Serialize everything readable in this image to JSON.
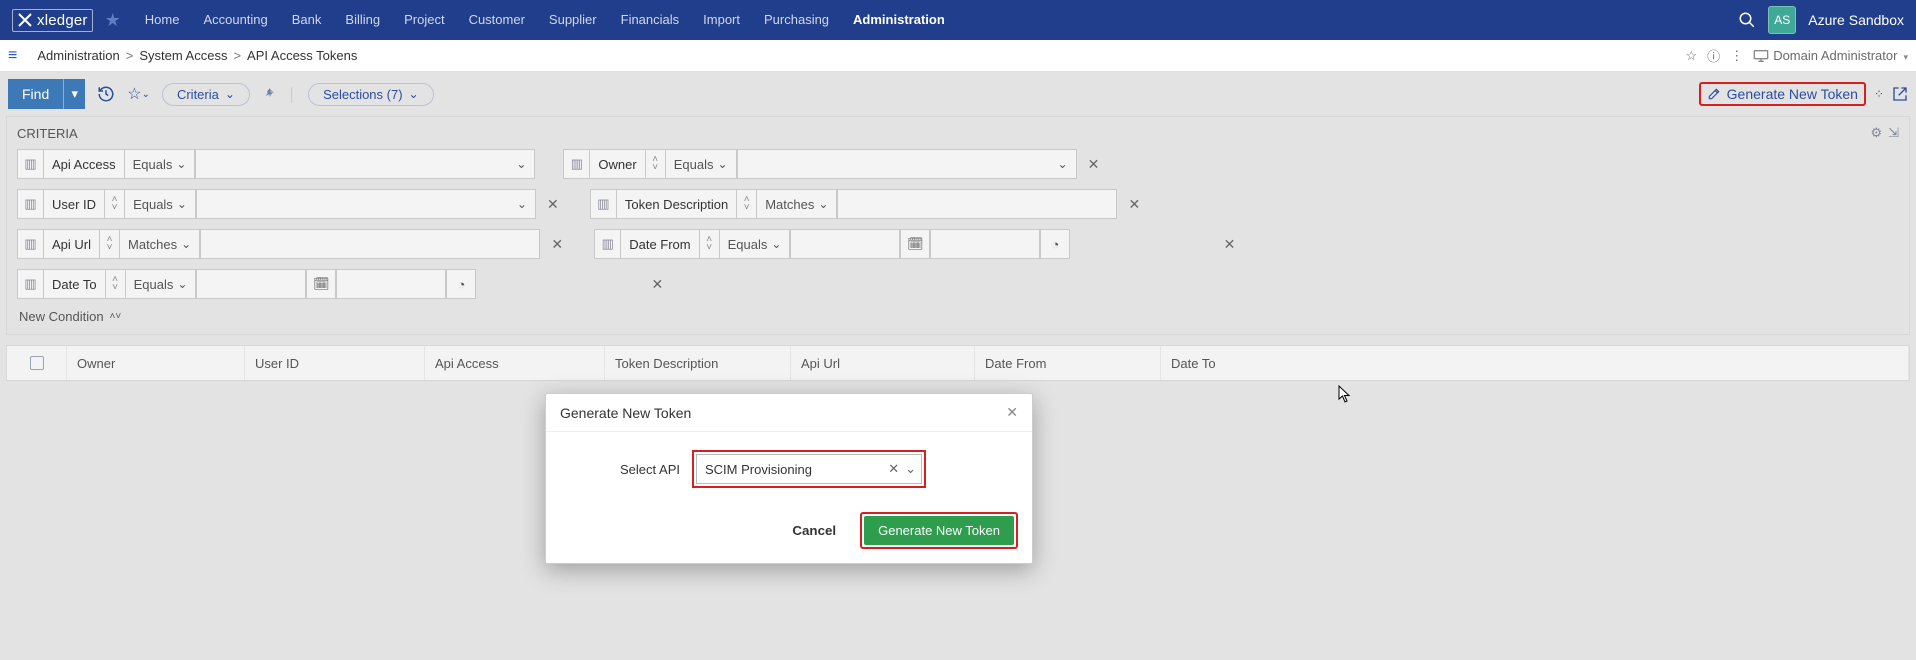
{
  "brand": {
    "name": "xledger"
  },
  "topnav": {
    "items": [
      "Home",
      "Accounting",
      "Bank",
      "Billing",
      "Project",
      "Customer",
      "Supplier",
      "Financials",
      "Import",
      "Purchasing",
      "Administration"
    ],
    "active_index": 10
  },
  "user": {
    "initials": "AS",
    "sandbox_label": "Azure Sandbox"
  },
  "breadcrumb": {
    "parts": [
      "Administration",
      "System Access",
      "API Access Tokens"
    ]
  },
  "role_display": "Domain Administrator",
  "toolbar": {
    "find_label": "Find",
    "criteria_chip": "Criteria",
    "selections_chip": "Selections (7)",
    "generate_link": "Generate New Token"
  },
  "criteria": {
    "title": "CRITERIA",
    "new_condition": "New Condition",
    "rows": {
      "api_access": {
        "label": "Api Access",
        "op": "Equals"
      },
      "owner": {
        "label": "Owner",
        "op": "Equals"
      },
      "user_id": {
        "label": "User ID",
        "op": "Equals"
      },
      "token_desc": {
        "label": "Token Description",
        "op": "Matches"
      },
      "api_url": {
        "label": "Api Url",
        "op": "Matches"
      },
      "date_from": {
        "label": "Date From",
        "op": "Equals"
      },
      "date_to": {
        "label": "Date To",
        "op": "Equals"
      }
    }
  },
  "table": {
    "cols": {
      "owner": "Owner",
      "user_id": "User ID",
      "api_access": "Api Access",
      "token_desc": "Token Description",
      "api_url": "Api Url",
      "date_from": "Date From",
      "date_to": "Date To"
    }
  },
  "modal": {
    "title": "Generate New Token",
    "field_label": "Select API",
    "field_value": "SCIM Provisioning",
    "cancel": "Cancel",
    "submit": "Generate New Token"
  }
}
